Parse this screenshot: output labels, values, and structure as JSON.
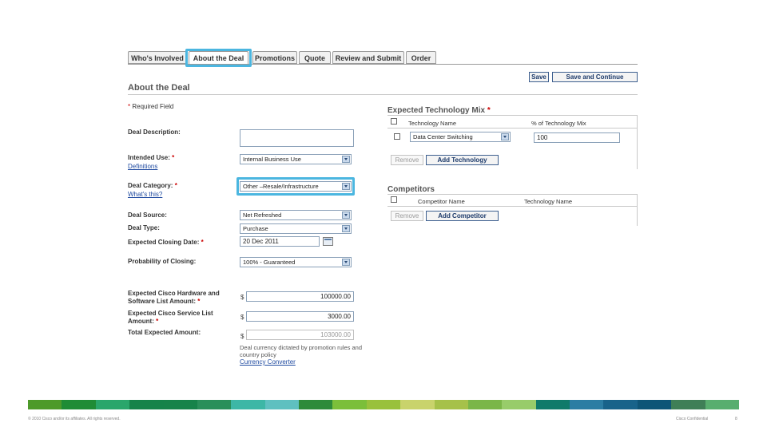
{
  "tabs": [
    {
      "label": "Who's Involved",
      "active": false
    },
    {
      "label": "About the Deal",
      "active": true
    },
    {
      "label": "Promotions",
      "active": false
    },
    {
      "label": "Quote",
      "active": false
    },
    {
      "label": "Review and Submit",
      "active": false
    },
    {
      "label": "Order",
      "active": false
    }
  ],
  "page_title": "About the Deal",
  "toolbar": {
    "save_label": "Save",
    "save_continue_label": "Save and Continue"
  },
  "required_note": {
    "asterisk": "*",
    "text": " Required Field"
  },
  "form": {
    "deal_description": {
      "label": "Deal Description:",
      "value": ""
    },
    "intended_use": {
      "label": "Intended Use:",
      "required": " *",
      "link": "Definitions",
      "value": "Internal Business Use"
    },
    "deal_category": {
      "label": "Deal Category:",
      "required": " *",
      "link": "What's this?",
      "value": "Other –Resale/Infrastructure"
    },
    "deal_source": {
      "label": "Deal Source:",
      "value": "Net Refreshed"
    },
    "deal_type": {
      "label": "Deal Type:",
      "value": "Purchase"
    },
    "closing_date": {
      "label": "Expected Closing Date:",
      "required": " *",
      "value": "20 Dec 2011"
    },
    "probability": {
      "label": "Probability of Closing:",
      "value": "100% - Guaranteed"
    },
    "hw_sw_amount": {
      "label_line1": "Expected Cisco Hardware and",
      "label_line2": "Software List Amount:",
      "required": " *",
      "currency": "$",
      "value": "100000.00"
    },
    "service_amount": {
      "label_line1": "Expected Cisco Service List",
      "label_line2": "Amount:",
      "required": " *",
      "currency": "$",
      "value": "3000.00"
    },
    "total_amount": {
      "label": "Total Expected Amount:",
      "currency": "$",
      "value": "103000.00"
    },
    "currency_note_line1": "Deal currency dictated by promotion rules and",
    "currency_note_line2": "country policy",
    "currency_link": "Currency Converter"
  },
  "tech_mix": {
    "title": "Expected Technology Mix",
    "required": " *",
    "col_technology": "Technology Name",
    "col_percent": "% of Technology Mix",
    "row": {
      "technology": "Data Center Switching",
      "percent": "100"
    },
    "remove_label": "Remove",
    "add_label": "Add Technology"
  },
  "competitors": {
    "title": "Competitors",
    "col_competitor": "Competitor Name",
    "col_technology": "Technology Name",
    "remove_label": "Remove",
    "add_label": "Add Competitor"
  },
  "footer": {
    "copyright": "© 2010 Cisco and/or its affiliates. All rights reserved.",
    "confidential": "Cisco Confidential",
    "page_number": "8",
    "colors": [
      "#4d9a2a",
      "#1f8c36",
      "#2aa66b",
      "#16834a",
      "#17834a",
      "#2a8f5a",
      "#3db7a6",
      "#5fc0c0",
      "#2e8b3a",
      "#7bbf3a",
      "#99c13c",
      "#c9d36c",
      "#a6c14a",
      "#7ab648",
      "#98cc6a",
      "#107a6a",
      "#2b7da3",
      "#18638a",
      "#0e5577",
      "#3f7f57",
      "#58ae6f"
    ]
  }
}
